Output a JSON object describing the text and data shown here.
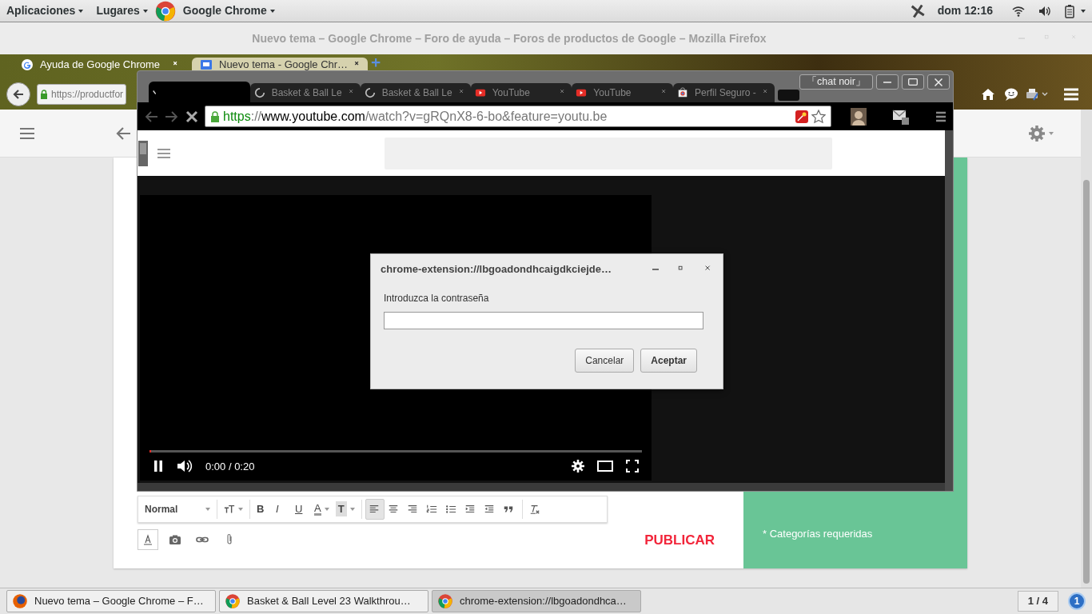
{
  "top_panel": {
    "menus": [
      "Aplicaciones",
      "Lugares",
      "Google Chrome"
    ],
    "clock": "dom 12:16"
  },
  "firefox": {
    "title": "Nuevo tema – Google Chrome – Foro de ayuda – Foros de productos de Google – Mozilla Firefox",
    "tabs": [
      {
        "label": "Ayuda de Google Chrome",
        "kind": "google",
        "selected": false
      },
      {
        "label": "Nuevo tema - Google Chr…",
        "kind": "forum",
        "selected": true
      }
    ],
    "url": "https://productfor",
    "editor_tools": [
      {
        "kind": "dropdown",
        "label": "Normal",
        "selected": false
      },
      {
        "kind": "text-size",
        "selected": false
      },
      {
        "kind": "bold",
        "label": "B",
        "selected": false
      },
      {
        "kind": "italic",
        "label": "I",
        "selected": false
      },
      {
        "kind": "underline",
        "label": "U",
        "selected": false
      },
      {
        "kind": "text-color",
        "label": "A",
        "selected": false
      },
      {
        "kind": "highlight",
        "label": "T",
        "selected": false
      },
      {
        "kind": "align-left",
        "selected": true
      },
      {
        "kind": "align-center",
        "selected": false
      },
      {
        "kind": "align-right",
        "selected": false
      },
      {
        "kind": "numbered-list",
        "selected": false
      },
      {
        "kind": "bulleted-list",
        "selected": false
      },
      {
        "kind": "indent",
        "selected": false
      },
      {
        "kind": "outdent",
        "selected": false
      },
      {
        "kind": "quote",
        "selected": false
      },
      {
        "kind": "clear-format",
        "selected": false
      }
    ],
    "attach_tools": [
      {
        "kind": "format",
        "selected": true
      },
      {
        "kind": "camera",
        "selected": false
      },
      {
        "kind": "link",
        "selected": false
      },
      {
        "kind": "clip",
        "selected": false
      }
    ],
    "publish": "PUBLICAR",
    "note": "* Categorías requeridas"
  },
  "chrome": {
    "profile": "「chat noir」",
    "tabs": [
      {
        "kind": "loading",
        "selected": true
      },
      {
        "label": "Basket & Ball Le",
        "kind": "spinner",
        "selected": false
      },
      {
        "label": "Basket & Ball Le",
        "kind": "spinner",
        "selected": false
      },
      {
        "label": "YouTube",
        "kind": "youtube",
        "selected": false
      },
      {
        "label": "YouTube",
        "kind": "youtube",
        "selected": false
      },
      {
        "label": "Perfil Seguro -",
        "kind": "store",
        "selected": false
      }
    ],
    "url": [
      {
        "text": "https",
        "kind": "scheme"
      },
      {
        "text": "://",
        "kind": "plain"
      },
      {
        "text": "www.youtube.com",
        "kind": "host"
      },
      {
        "text": "/watch?v=gRQnX8-6-bo&feature=youtu.be",
        "kind": "plain"
      }
    ],
    "player": {
      "playing": true,
      "level": 0,
      "time": "0:00 / 0:20"
    }
  },
  "dialog": {
    "title": "chrome-extension://lbgoadondhcaigdkciejde…",
    "label": "Introduzca la contraseña",
    "buttons": [
      {
        "label": "Cancelar",
        "default": false
      },
      {
        "label": "Aceptar",
        "default": true
      }
    ]
  },
  "taskbar": {
    "items": [
      {
        "label": "Nuevo tema – Google Chrome – F…",
        "kind": "firefox",
        "selected": false
      },
      {
        "label": "Basket & Ball Level 23 Walkthrou…",
        "kind": "chrome",
        "selected": false
      },
      {
        "label": "chrome-extension://lbgoadondhca…",
        "kind": "chrome",
        "selected": true
      }
    ],
    "workspace": "1 / 4",
    "notifications": "1"
  }
}
